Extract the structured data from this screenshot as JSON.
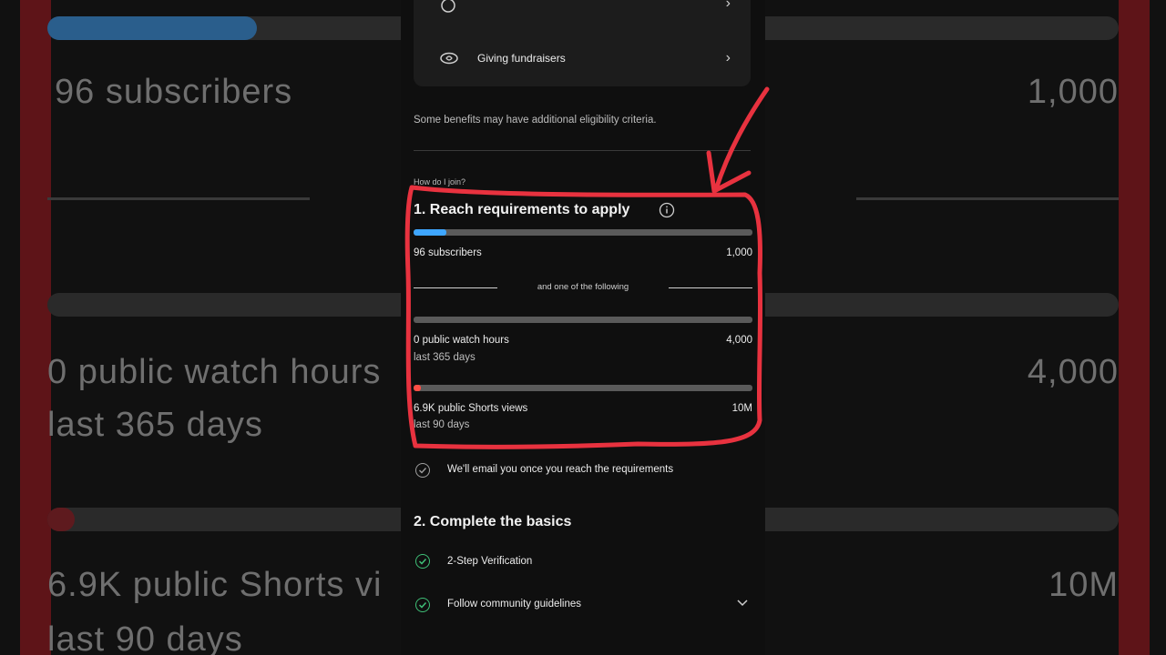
{
  "background": {
    "subs_text": "96 subscribers",
    "subs_goal": "1,000",
    "watch_text": "0 public watch hours",
    "watch_sub": "last 365 days",
    "watch_goal": "4,000",
    "shorts_text": "6.9K public Shorts vi",
    "shorts_sub": "last 90 days",
    "shorts_goal": "10M"
  },
  "benefits": {
    "giving_label": "Giving fundraisers"
  },
  "note": "Some benefits may have additional eligibility criteria.",
  "how_join": "How do I join?",
  "step1": {
    "title": "1. Reach requirements to apply",
    "subscribers": {
      "label": "96 subscribers",
      "goal": "1,000",
      "progress": 0.096
    },
    "divider_text": "and one of the following",
    "watch": {
      "label": "0 public watch hours",
      "sub": "last 365 days",
      "goal": "4,000",
      "progress": 0.0
    },
    "shorts": {
      "label": "6.9K public Shorts views",
      "sub": "last 90 days",
      "goal": "10M",
      "progress": 0.0007
    },
    "email_note": "We'll email you once you reach the requirements"
  },
  "step2": {
    "title": "2. Complete the basics",
    "items": [
      {
        "label": "2-Step Verification"
      },
      {
        "label": "Follow community guidelines"
      }
    ]
  },
  "colors": {
    "accent_blue": "#3ea6ff",
    "shorts_red": "#ff4e45",
    "annotation_red": "#e8323f"
  }
}
